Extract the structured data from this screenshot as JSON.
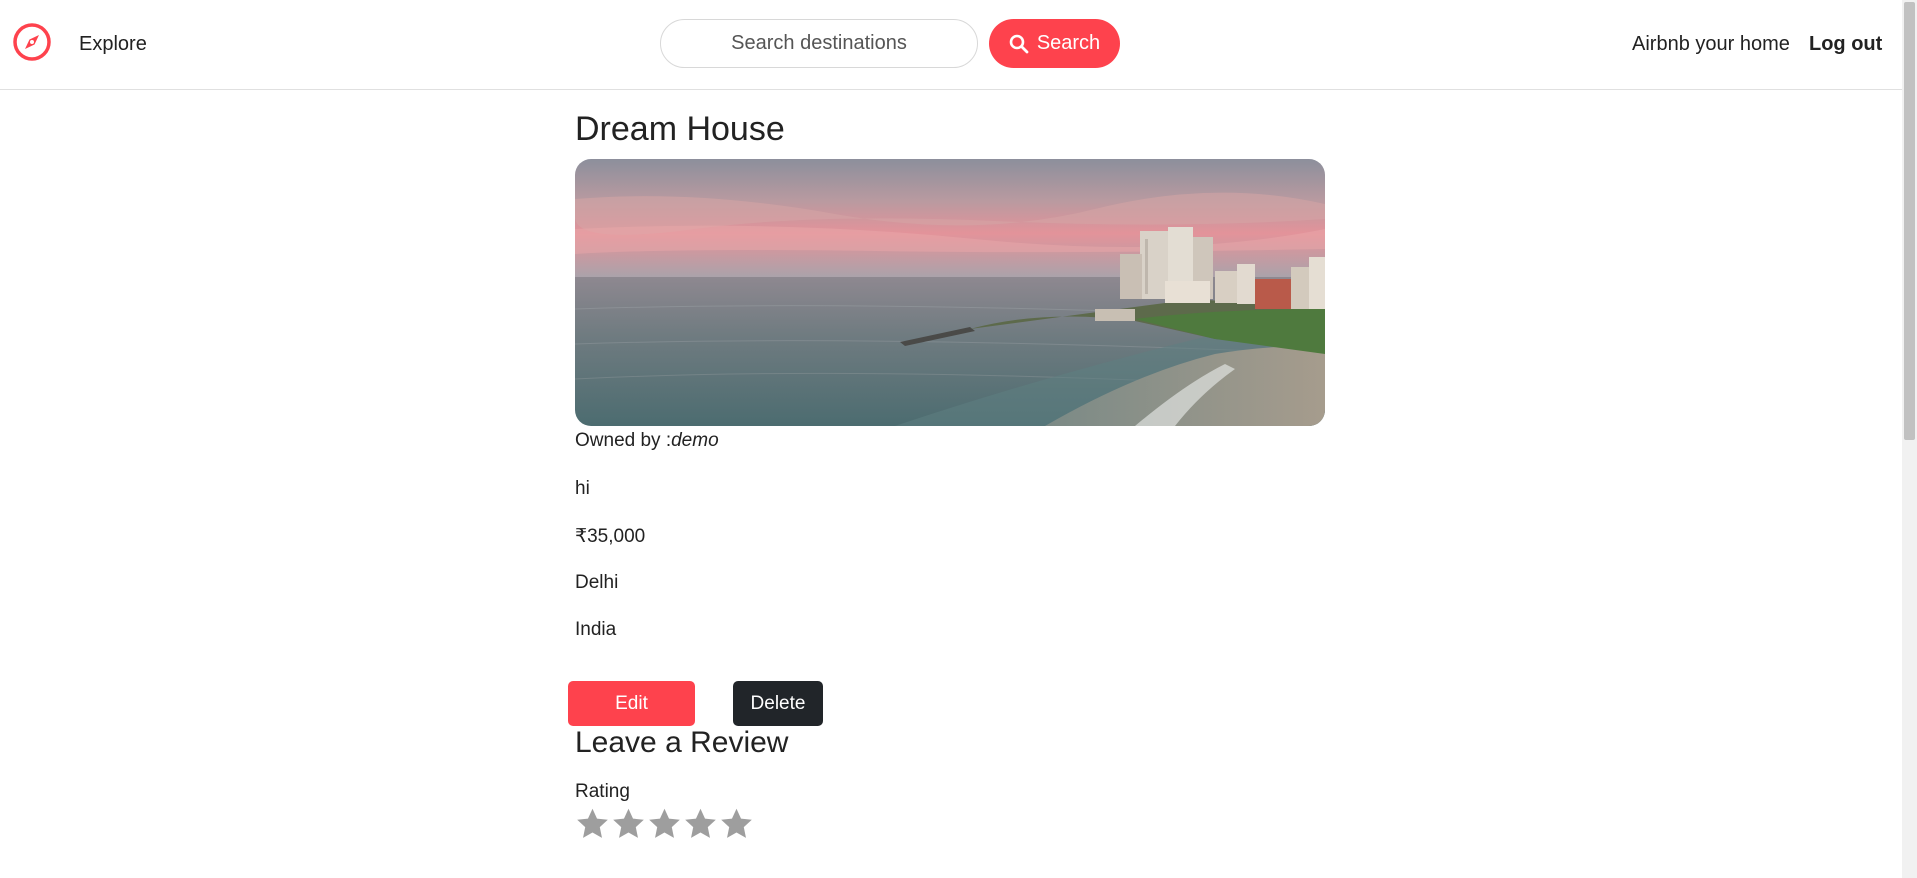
{
  "navbar": {
    "explore_label": "Explore",
    "search_placeholder": "Search destinations",
    "search_button_label": "Search",
    "host_label": "Airbnb your home",
    "logout_label": "Log out"
  },
  "listing": {
    "title": "Dream House",
    "owner_prefix": "Owned by :",
    "owner": "demo",
    "description": "hi",
    "price": "₹35,000",
    "city": "Delhi",
    "country": "India"
  },
  "actions": {
    "edit_label": "Edit",
    "delete_label": "Delete"
  },
  "review": {
    "heading": "Leave a Review",
    "rating_label": "Rating",
    "stars_count": 5,
    "selected_rating": 0
  },
  "colors": {
    "brand": "#fe424d",
    "dark_button": "#212529",
    "star_empty": "#9e9e9e"
  }
}
